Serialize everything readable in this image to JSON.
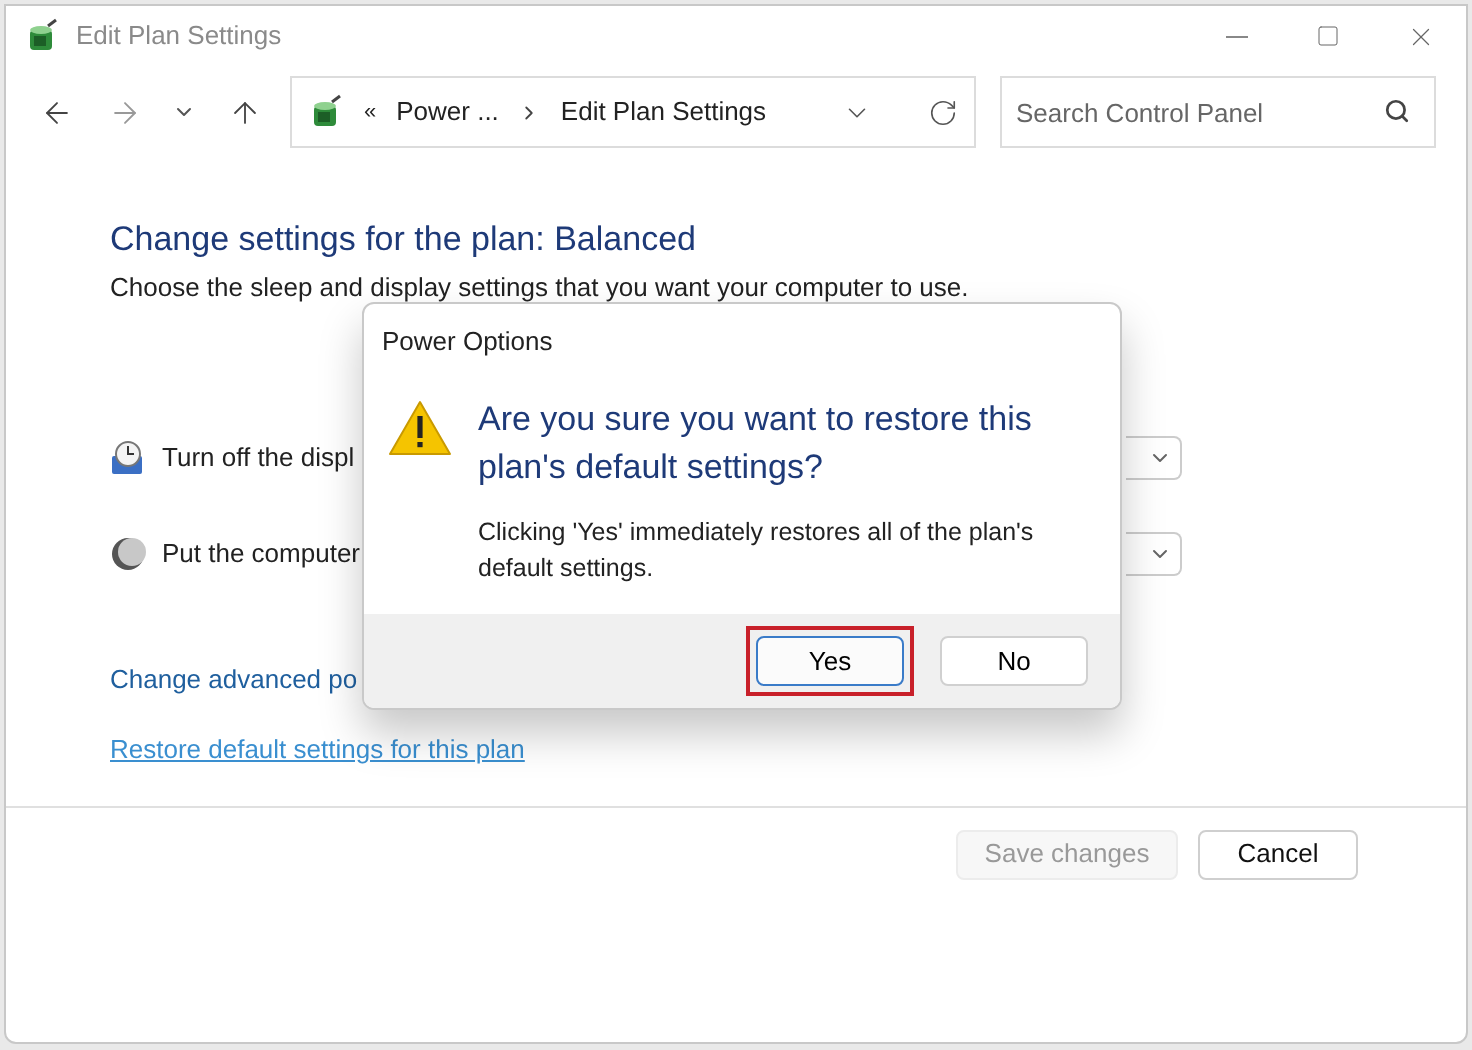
{
  "window": {
    "title": "Edit Plan Settings"
  },
  "address": {
    "crumbs": [
      "«",
      "Power ...",
      "Edit Plan Settings"
    ]
  },
  "search": {
    "placeholder": "Search Control Panel"
  },
  "main": {
    "heading": "Change settings for the plan: Balanced",
    "description": "Choose the sleep and display settings that you want your computer to use.",
    "settings": [
      {
        "kind": "display",
        "label": "Turn off the displ"
      },
      {
        "kind": "sleep",
        "label": "Put the computer"
      }
    ],
    "links": [
      {
        "label": "Change advanced po",
        "visited": false
      },
      {
        "label": "Restore default settings for this plan",
        "visited": true
      }
    ],
    "buttons": [
      {
        "label": "Save changes",
        "disabled": true
      },
      {
        "label": "Cancel",
        "disabled": false
      }
    ]
  },
  "dialog": {
    "title": "Power Options",
    "heading": "Are you sure you want to restore this plan's default settings?",
    "message": "Clicking 'Yes' immediately restores all of the plan's default settings.",
    "buttons": [
      {
        "label": "Yes",
        "focused": true,
        "highlighted": true
      },
      {
        "label": "No",
        "focused": false,
        "highlighted": false
      }
    ]
  }
}
